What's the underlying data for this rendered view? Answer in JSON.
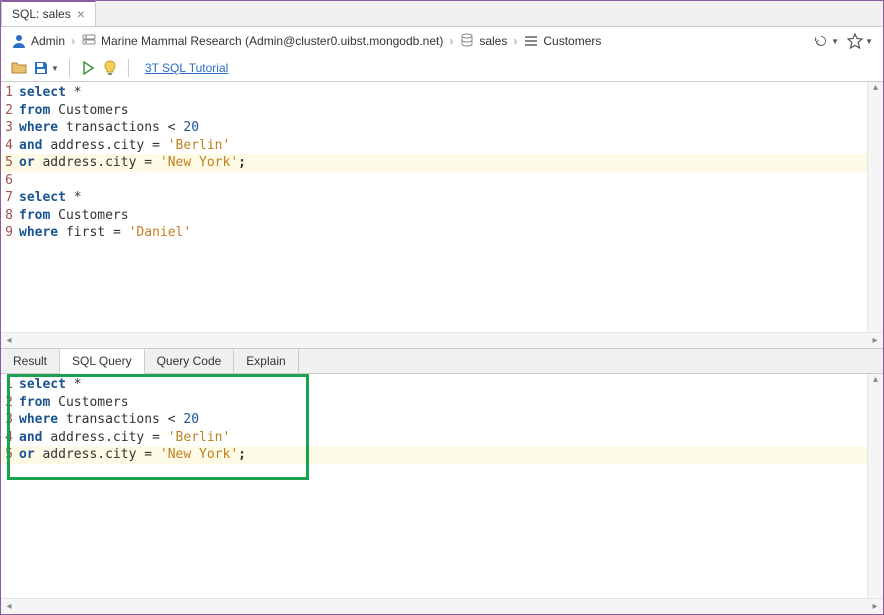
{
  "tab": {
    "label": "SQL: sales"
  },
  "breadcrumb": {
    "user": "Admin",
    "connection": "Marine Mammal Research (Admin@cluster0.uibst.mongodb.net)",
    "database": "sales",
    "collection": "Customers"
  },
  "toolbar": {
    "tutorial_link": "3T SQL Tutorial"
  },
  "editor": {
    "lines": [
      {
        "n": "1",
        "tokens": [
          {
            "t": "kw",
            "v": "select "
          },
          {
            "t": "op",
            "v": "*"
          }
        ]
      },
      {
        "n": "2",
        "tokens": [
          {
            "t": "kw",
            "v": "from "
          },
          {
            "t": "ident",
            "v": "Customers"
          }
        ]
      },
      {
        "n": "3",
        "tokens": [
          {
            "t": "kw",
            "v": "where "
          },
          {
            "t": "ident",
            "v": "transactions "
          },
          {
            "t": "op",
            "v": "< "
          },
          {
            "t": "num",
            "v": "20"
          }
        ]
      },
      {
        "n": "4",
        "tokens": [
          {
            "t": "kw",
            "v": "and "
          },
          {
            "t": "ident",
            "v": "address.city "
          },
          {
            "t": "op",
            "v": "= "
          },
          {
            "t": "str",
            "v": "'Berlin'"
          }
        ]
      },
      {
        "n": "5",
        "hl": true,
        "tokens": [
          {
            "t": "kw",
            "v": "or "
          },
          {
            "t": "ident",
            "v": "address.city "
          },
          {
            "t": "op",
            "v": "= "
          },
          {
            "t": "str",
            "v": "'New York'"
          },
          {
            "t": "semi",
            "v": ";"
          }
        ]
      },
      {
        "n": "6",
        "tokens": []
      },
      {
        "n": "7",
        "tokens": [
          {
            "t": "kw",
            "v": "select "
          },
          {
            "t": "op",
            "v": "*"
          }
        ]
      },
      {
        "n": "8",
        "tokens": [
          {
            "t": "kw",
            "v": "from "
          },
          {
            "t": "ident",
            "v": "Customers"
          }
        ]
      },
      {
        "n": "9",
        "tokens": [
          {
            "t": "kw",
            "v": "where "
          },
          {
            "t": "ident",
            "v": "first "
          },
          {
            "t": "op",
            "v": "= "
          },
          {
            "t": "str",
            "v": "'Daniel'"
          }
        ]
      }
    ]
  },
  "result_tabs": [
    "Result",
    "SQL Query",
    "Query Code",
    "Explain"
  ],
  "result_active_tab": 1,
  "result_query": {
    "lines": [
      {
        "n": "1",
        "tokens": [
          {
            "t": "kw",
            "v": "select "
          },
          {
            "t": "op",
            "v": "*"
          }
        ]
      },
      {
        "n": "2",
        "tokens": [
          {
            "t": "kw",
            "v": "from "
          },
          {
            "t": "ident",
            "v": "Customers"
          }
        ]
      },
      {
        "n": "3",
        "tokens": [
          {
            "t": "kw",
            "v": "where "
          },
          {
            "t": "ident",
            "v": "transactions "
          },
          {
            "t": "op",
            "v": "< "
          },
          {
            "t": "num",
            "v": "20"
          }
        ]
      },
      {
        "n": "4",
        "tokens": [
          {
            "t": "kw",
            "v": "and "
          },
          {
            "t": "ident",
            "v": "address.city "
          },
          {
            "t": "op",
            "v": "= "
          },
          {
            "t": "str",
            "v": "'Berlin'"
          }
        ]
      },
      {
        "n": "5",
        "hl": true,
        "tokens": [
          {
            "t": "kw",
            "v": "or "
          },
          {
            "t": "ident",
            "v": "address.city "
          },
          {
            "t": "op",
            "v": "= "
          },
          {
            "t": "str",
            "v": "'New York'"
          },
          {
            "t": "semi",
            "v": ";"
          }
        ]
      }
    ]
  }
}
